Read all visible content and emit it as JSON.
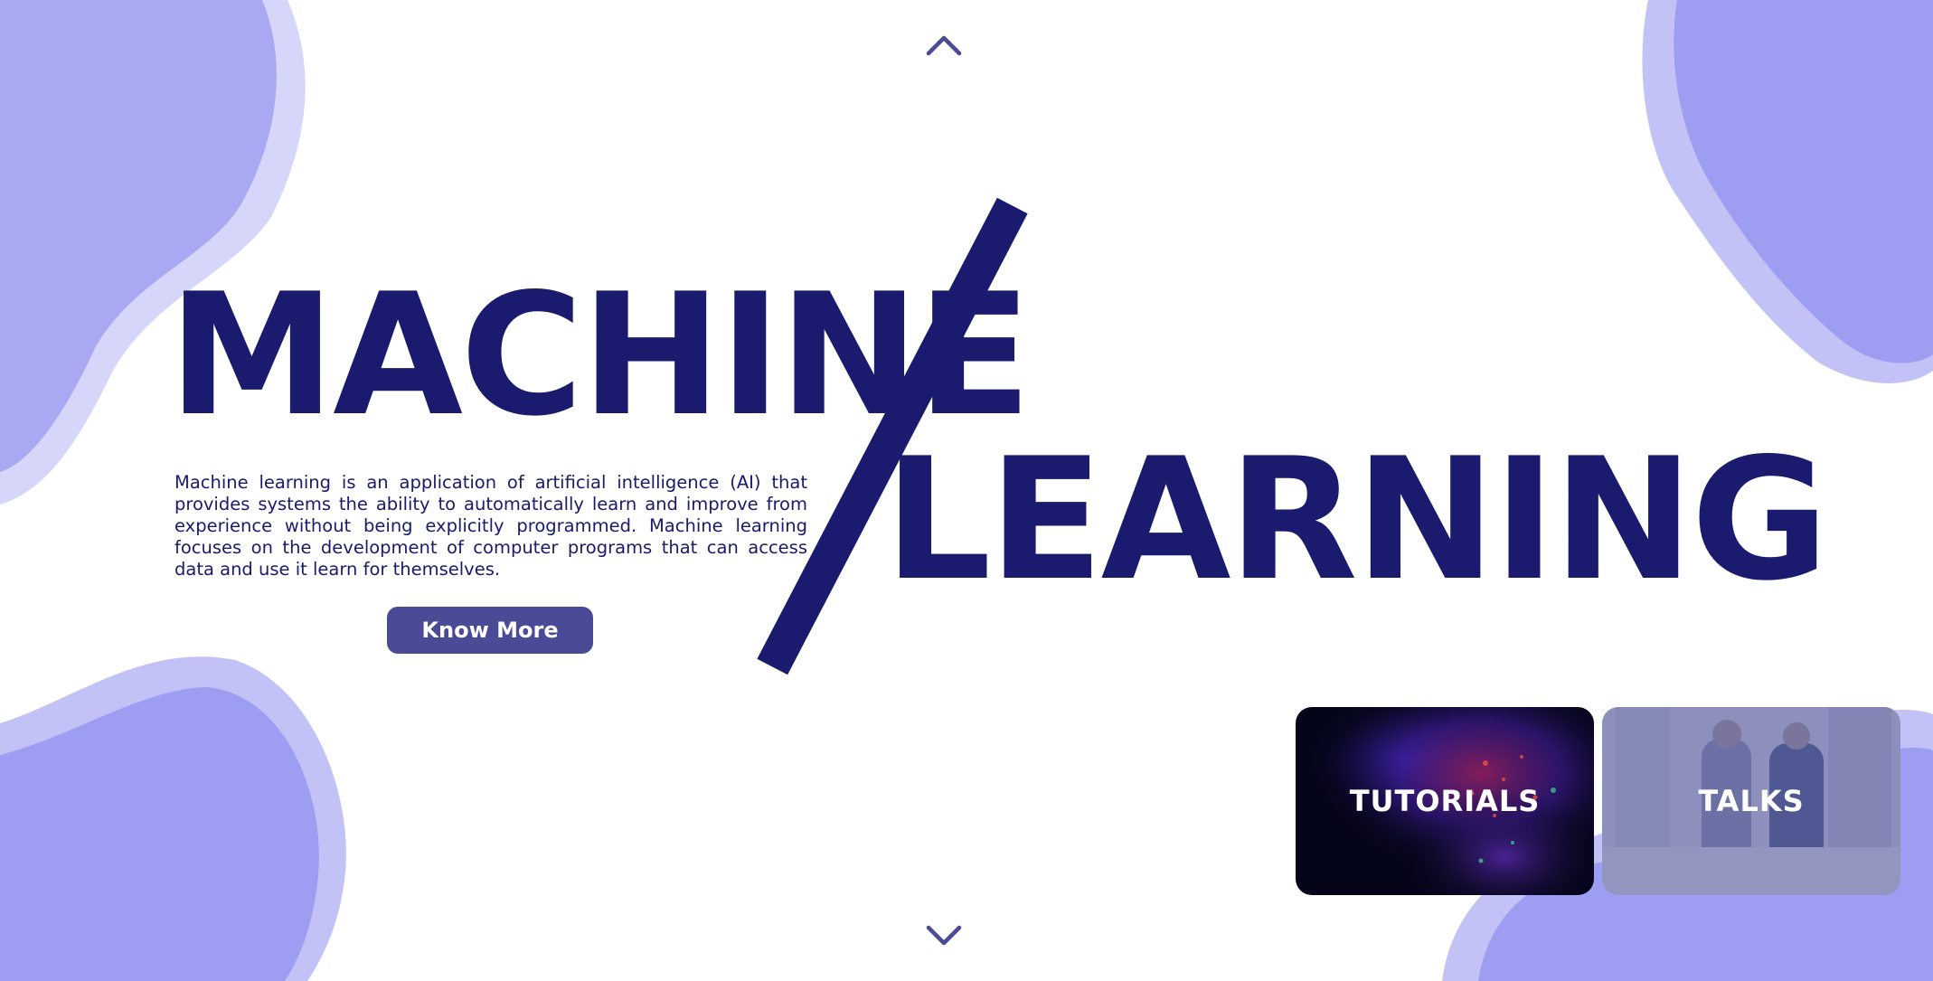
{
  "colors": {
    "brand_navy": "#1a1a6e",
    "button_bg": "#4a4a96",
    "blob_light": "#d6d6fa",
    "blob_mid": "#c2c2f7",
    "blob_main": "#a3a3f2"
  },
  "nav": {
    "up_icon": "chevron-up-icon",
    "down_icon": "chevron-down-icon"
  },
  "hero": {
    "title_line1": "MACHINE",
    "title_line2": "LEARNING",
    "description": "Machine learning is an application of artificial intelligence (AI) that provides systems the ability to automatically learn and improve from experience without being explicitly programmed. Machine learning focuses on the development of computer programs that can access data and use it learn for themselves.",
    "cta_label": "Know More"
  },
  "cards": [
    {
      "label": "TUTORIALS"
    },
    {
      "label": "TALKS"
    }
  ]
}
